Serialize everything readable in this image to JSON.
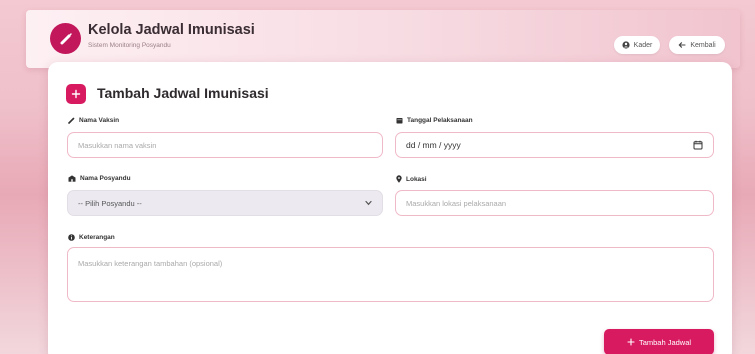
{
  "header": {
    "title": "Kelola Jadwal Imunisasi",
    "subtitle": "Sistem Monitoring Posyandu",
    "kader_label": "Kader",
    "kembali_label": "Kembali"
  },
  "form": {
    "title": "Tambah Jadwal Imunisasi",
    "vaccine": {
      "label": "Nama Vaksin",
      "placeholder": "Masukkan nama vaksin"
    },
    "date": {
      "label": "Tanggal Pelaksanaan",
      "value": "dd / mm / yyyy"
    },
    "posyandu": {
      "label": "Nama Posyandu",
      "value": "-- Pilih Posyandu --"
    },
    "location": {
      "label": "Lokasi",
      "placeholder": "Masukkan lokasi pelaksanaan"
    },
    "notes": {
      "label": "Keterangan",
      "placeholder": "Masukkan keterangan tambahan (opsional)"
    },
    "submit_label": "Tambah Jadwal"
  },
  "colors": {
    "accent": "#d81b60",
    "logo": "#c2185b",
    "field_border": "#f0b9c8"
  },
  "icons": {
    "logo": "syringe-icon",
    "kader": "user-circle-icon",
    "kembali": "arrow-left-icon",
    "form_title": "plus-square-icon",
    "vaccine": "syringe-small-icon",
    "date": "calendar-icon",
    "posyandu": "clinic-icon",
    "location": "map-pin-icon",
    "notes": "info-circle-icon",
    "submit": "plus-icon"
  }
}
